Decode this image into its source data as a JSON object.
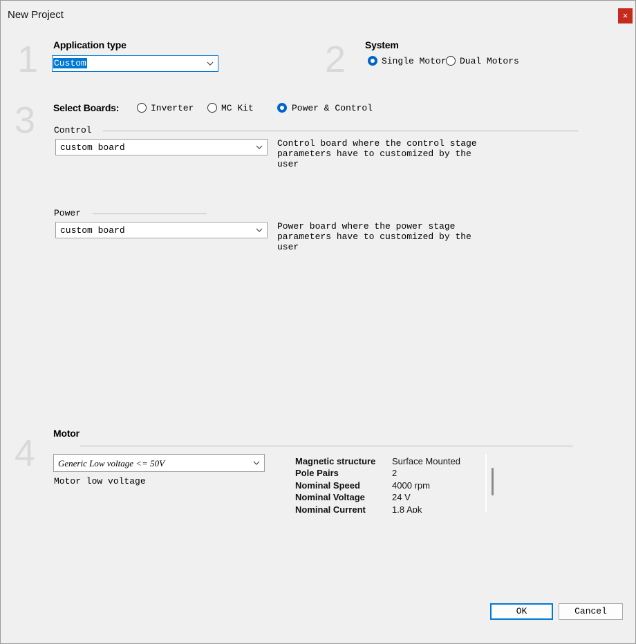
{
  "window": {
    "title": "New Project",
    "close_glyph": "×"
  },
  "steps": [
    "1",
    "2",
    "3",
    "4"
  ],
  "application_type": {
    "heading": "Application type",
    "selected": "Custom"
  },
  "system": {
    "heading": "System",
    "options": [
      {
        "label": "Single Motor",
        "checked": true
      },
      {
        "label": "Dual Motors",
        "checked": false
      }
    ]
  },
  "select_boards": {
    "heading": "Select Boards:",
    "options": [
      {
        "label": "Inverter",
        "checked": false
      },
      {
        "label": "MC Kit",
        "checked": false
      },
      {
        "label": "Power & Control",
        "checked": true
      }
    ]
  },
  "control": {
    "label": "Control",
    "selected": "custom board",
    "description": [
      "Control board where the control stage",
      "parameters have to customized by the",
      "user"
    ]
  },
  "power": {
    "label": "Power",
    "selected": "custom board",
    "description": [
      "Power board where the power stage",
      "parameters have to customized by the",
      "user"
    ]
  },
  "motor": {
    "heading": "Motor",
    "selected": "Generic Low voltage <= 50V",
    "caption": "Motor low voltage",
    "specs": [
      {
        "label": "Magnetic structure",
        "value": "Surface Mounted"
      },
      {
        "label": "Pole Pairs",
        "value": "2"
      },
      {
        "label": "Nominal Speed",
        "value": "4000 rpm"
      },
      {
        "label": "Nominal Voltage",
        "value": "24 V"
      },
      {
        "label": "Nominal Current",
        "value": "1.8 Apk"
      }
    ]
  },
  "buttons": {
    "ok": "OK",
    "cancel": "Cancel"
  },
  "colors": {
    "accent": "#0078d4",
    "close": "#c42b1c",
    "step_digits": "#d9d9d9"
  },
  "icons": {
    "dropdown": "chevron-down-icon",
    "close": "close-icon"
  }
}
